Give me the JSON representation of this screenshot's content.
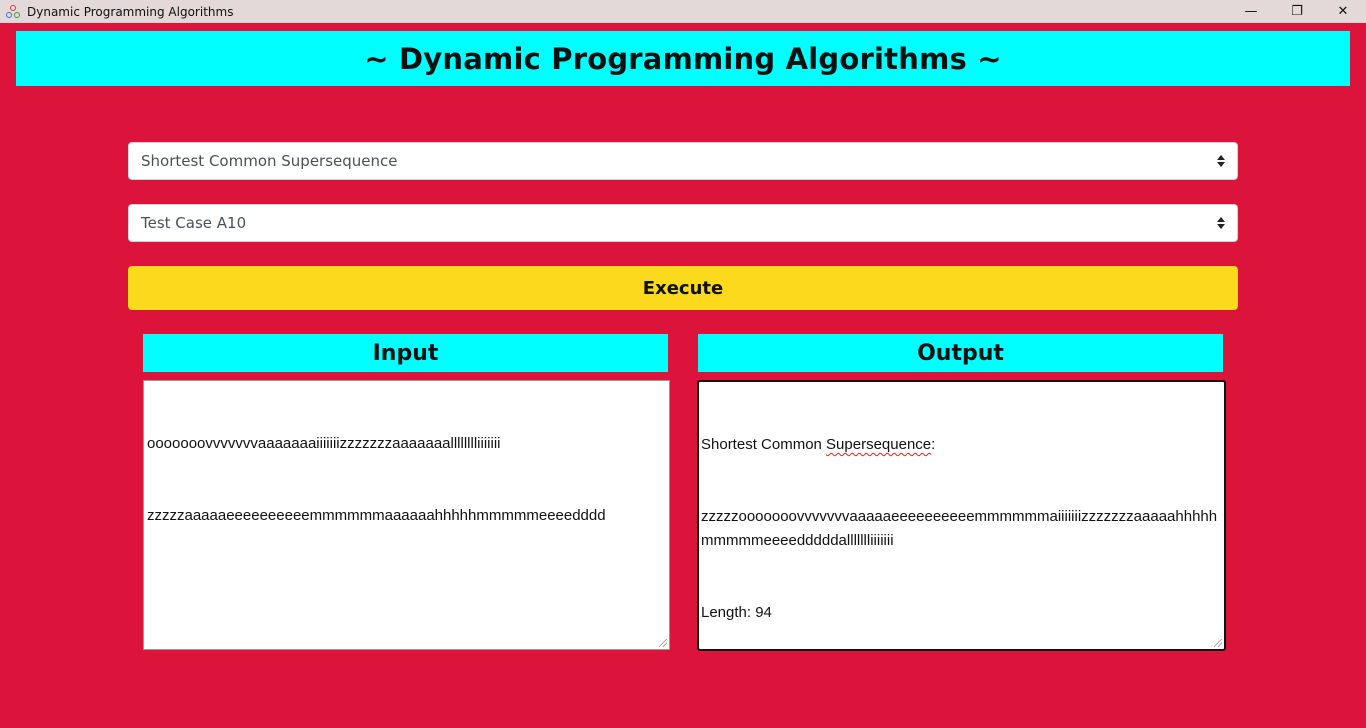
{
  "window": {
    "title": "Dynamic Programming Algorithms",
    "minimize_glyph": "—",
    "restore_glyph": "❐",
    "close_glyph": "✕"
  },
  "header": {
    "title": "~ Dynamic Programming Algorithms ~"
  },
  "algorithm_select": {
    "selected": "Shortest Common Supersequence"
  },
  "testcase_select": {
    "selected": "Test Case A10"
  },
  "execute_button": {
    "label": "Execute"
  },
  "input_panel": {
    "heading": "Input",
    "line1": "ooooooovvvvvvvaaaaaaaiiiiiiizzzzzzzaaaaaaalllllllliiiiiii",
    "line2": "zzzzzaaaaaeeeeeeeeeemmmmmmaaaaaahhhhhmmmmmeeeedddd"
  },
  "output_panel": {
    "heading": "Output",
    "label_prefix": "Shortest Common ",
    "label_word": "Supersequence",
    "label_suffix": ":",
    "result": "zzzzzooooooovvvvvvvaaaaaeeeeeeeeeemmmmmmaiiiiiiizzzzzzzaaaaahhhhhmmmmmeeeedddddallllllliiiiiii",
    "length_line": "Length: 94"
  },
  "colors": {
    "background": "#dc143c",
    "header_bg": "#00ffff",
    "button_bg": "#fbd91c",
    "titlebar_bg": "#e3d9d9"
  }
}
